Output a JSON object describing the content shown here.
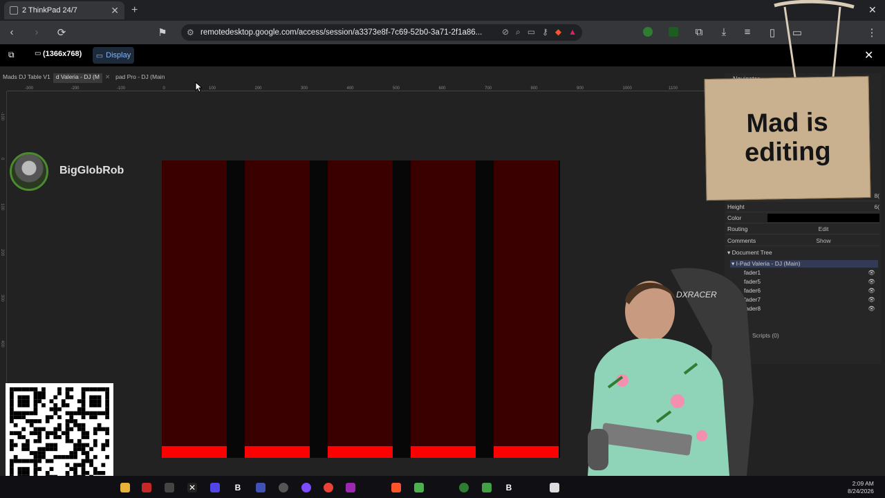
{
  "browser": {
    "tab_title": "2 ThinkPad 24/7",
    "url": "remotedesktop.google.com/access/session/a3373e8f-7c69-52b0-3a71-2f1a86..."
  },
  "remote_desktop": {
    "resolution": "(1366x768)",
    "display_button": "Display"
  },
  "editor": {
    "doc_tabs": [
      "Mads DJ Table V1",
      "d Valeria - DJ (M",
      "pad Pro - DJ (Main"
    ],
    "ruler_ticks": [
      "-300",
      "-200",
      "-100",
      "0",
      "100",
      "200",
      "300",
      "400",
      "500",
      "600",
      "700",
      "800",
      "900",
      "1000",
      "1100"
    ],
    "vruler_ticks": [
      "-100",
      "0",
      "100",
      "200",
      "300",
      "400"
    ],
    "faders": [
      {
        "name": "fader1",
        "level": 0.04
      },
      {
        "name": "fader5",
        "level": 0.04
      },
      {
        "name": "fader6",
        "level": 0.04
      },
      {
        "name": "fader7",
        "level": 0.04
      },
      {
        "name": "fader8",
        "level": 0.04
      }
    ],
    "fader_color": "#3a0000",
    "fader_fill_color": "#ff0000"
  },
  "panel": {
    "navigator_label": "Navigator",
    "width_value": "8(",
    "height_label": "Height",
    "height_value": "6(",
    "color_label": "Color",
    "routing_label": "Routing",
    "routing_action": "Edit",
    "comments_label": "Comments",
    "comments_action": "Show",
    "document_tree_label": "Document Tree",
    "tree_root": "I-Pad Valeria - DJ (Main)",
    "tree_items": [
      "fader1",
      "fader5",
      "fader6",
      "fader7",
      "fader8"
    ],
    "scripts_label": "Scripts (0)"
  },
  "overlay": {
    "streamer_name": "BigGlobRob",
    "sign_text": "Mad is editing"
  },
  "taskbar": {
    "time": "2:09 AM",
    "date": "8/24/2026"
  },
  "icons": [
    "back-icon",
    "forward-icon",
    "reload-icon",
    "bookmark-icon",
    "extensions-icon",
    "download-icon",
    "close-icon"
  ]
}
